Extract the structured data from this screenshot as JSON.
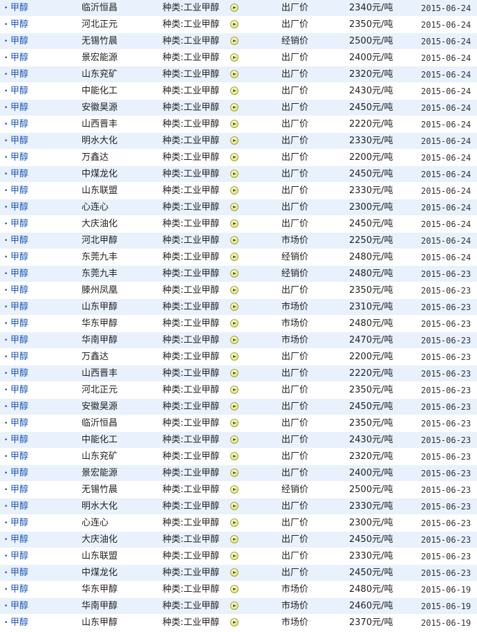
{
  "colors": {
    "row_alt_bg": "#e9f1fc",
    "row_bg": "#ffffff",
    "link": "#1b57b8",
    "icon": "#f1ee9a"
  },
  "icons": {
    "bullet": "•",
    "go": "arrow-go-icon"
  },
  "rows": [
    {
      "product": "甲醇",
      "company": "临沂恒昌",
      "category": "种类:工业甲醇",
      "price_type": "出厂价",
      "price": "2340元/吨",
      "date": "2015-06-24"
    },
    {
      "product": "甲醇",
      "company": "河北正元",
      "category": "种类:工业甲醇",
      "price_type": "出厂价",
      "price": "2350元/吨",
      "date": "2015-06-24"
    },
    {
      "product": "甲醇",
      "company": "无锡竹晨",
      "category": "种类:工业甲醇",
      "price_type": "经销价",
      "price": "2500元/吨",
      "date": "2015-06-24"
    },
    {
      "product": "甲醇",
      "company": "景宏能源",
      "category": "种类:工业甲醇",
      "price_type": "出厂价",
      "price": "2400元/吨",
      "date": "2015-06-24"
    },
    {
      "product": "甲醇",
      "company": "山东兖矿",
      "category": "种类:工业甲醇",
      "price_type": "出厂价",
      "price": "2320元/吨",
      "date": "2015-06-24"
    },
    {
      "product": "甲醇",
      "company": "中能化工",
      "category": "种类:工业甲醇",
      "price_type": "出厂价",
      "price": "2430元/吨",
      "date": "2015-06-24"
    },
    {
      "product": "甲醇",
      "company": "安徽昊源",
      "category": "种类:工业甲醇",
      "price_type": "出厂价",
      "price": "2450元/吨",
      "date": "2015-06-24"
    },
    {
      "product": "甲醇",
      "company": "山西晋丰",
      "category": "种类:工业甲醇",
      "price_type": "出厂价",
      "price": "2220元/吨",
      "date": "2015-06-24"
    },
    {
      "product": "甲醇",
      "company": "明水大化",
      "category": "种类:工业甲醇",
      "price_type": "出厂价",
      "price": "2330元/吨",
      "date": "2015-06-24"
    },
    {
      "product": "甲醇",
      "company": "万鑫达",
      "category": "种类:工业甲醇",
      "price_type": "出厂价",
      "price": "2200元/吨",
      "date": "2015-06-24"
    },
    {
      "product": "甲醇",
      "company": "中煤龙化",
      "category": "种类:工业甲醇",
      "price_type": "出厂价",
      "price": "2450元/吨",
      "date": "2015-06-24"
    },
    {
      "product": "甲醇",
      "company": "山东联盟",
      "category": "种类:工业甲醇",
      "price_type": "出厂价",
      "price": "2330元/吨",
      "date": "2015-06-24"
    },
    {
      "product": "甲醇",
      "company": "心连心",
      "category": "种类:工业甲醇",
      "price_type": "出厂价",
      "price": "2300元/吨",
      "date": "2015-06-24"
    },
    {
      "product": "甲醇",
      "company": "大庆油化",
      "category": "种类:工业甲醇",
      "price_type": "出厂价",
      "price": "2450元/吨",
      "date": "2015-06-24"
    },
    {
      "product": "甲醇",
      "company": "河北甲醇",
      "category": "种类:工业甲醇",
      "price_type": "市场价",
      "price": "2250元/吨",
      "date": "2015-06-24"
    },
    {
      "product": "甲醇",
      "company": "东莞九丰",
      "category": "种类:工业甲醇",
      "price_type": "经销价",
      "price": "2480元/吨",
      "date": "2015-06-24"
    },
    {
      "product": "甲醇",
      "company": "东莞九丰",
      "category": "种类:工业甲醇",
      "price_type": "经销价",
      "price": "2480元/吨",
      "date": "2015-06-23"
    },
    {
      "product": "甲醇",
      "company": "滕州凤凰",
      "category": "种类:工业甲醇",
      "price_type": "出厂价",
      "price": "2350元/吨",
      "date": "2015-06-23"
    },
    {
      "product": "甲醇",
      "company": "山东甲醇",
      "category": "种类:工业甲醇",
      "price_type": "市场价",
      "price": "2310元/吨",
      "date": "2015-06-23"
    },
    {
      "product": "甲醇",
      "company": "华东甲醇",
      "category": "种类:工业甲醇",
      "price_type": "市场价",
      "price": "2480元/吨",
      "date": "2015-06-23"
    },
    {
      "product": "甲醇",
      "company": "华南甲醇",
      "category": "种类:工业甲醇",
      "price_type": "市场价",
      "price": "2470元/吨",
      "date": "2015-06-23"
    },
    {
      "product": "甲醇",
      "company": "万鑫达",
      "category": "种类:工业甲醇",
      "price_type": "出厂价",
      "price": "2200元/吨",
      "date": "2015-06-23"
    },
    {
      "product": "甲醇",
      "company": "山西晋丰",
      "category": "种类:工业甲醇",
      "price_type": "出厂价",
      "price": "2220元/吨",
      "date": "2015-06-23"
    },
    {
      "product": "甲醇",
      "company": "河北正元",
      "category": "种类:工业甲醇",
      "price_type": "出厂价",
      "price": "2350元/吨",
      "date": "2015-06-23"
    },
    {
      "product": "甲醇",
      "company": "安徽昊源",
      "category": "种类:工业甲醇",
      "price_type": "出厂价",
      "price": "2450元/吨",
      "date": "2015-06-23"
    },
    {
      "product": "甲醇",
      "company": "临沂恒昌",
      "category": "种类:工业甲醇",
      "price_type": "出厂价",
      "price": "2350元/吨",
      "date": "2015-06-23"
    },
    {
      "product": "甲醇",
      "company": "中能化工",
      "category": "种类:工业甲醇",
      "price_type": "出厂价",
      "price": "2430元/吨",
      "date": "2015-06-23"
    },
    {
      "product": "甲醇",
      "company": "山东兖矿",
      "category": "种类:工业甲醇",
      "price_type": "出厂价",
      "price": "2320元/吨",
      "date": "2015-06-23"
    },
    {
      "product": "甲醇",
      "company": "景宏能源",
      "category": "种类:工业甲醇",
      "price_type": "出厂价",
      "price": "2400元/吨",
      "date": "2015-06-23"
    },
    {
      "product": "甲醇",
      "company": "无锡竹晨",
      "category": "种类:工业甲醇",
      "price_type": "经销价",
      "price": "2500元/吨",
      "date": "2015-06-23"
    },
    {
      "product": "甲醇",
      "company": "明水大化",
      "category": "种类:工业甲醇",
      "price_type": "出厂价",
      "price": "2330元/吨",
      "date": "2015-06-23"
    },
    {
      "product": "甲醇",
      "company": "心连心",
      "category": "种类:工业甲醇",
      "price_type": "出厂价",
      "price": "2300元/吨",
      "date": "2015-06-23"
    },
    {
      "product": "甲醇",
      "company": "大庆油化",
      "category": "种类:工业甲醇",
      "price_type": "出厂价",
      "price": "2450元/吨",
      "date": "2015-06-23"
    },
    {
      "product": "甲醇",
      "company": "山东联盟",
      "category": "种类:工业甲醇",
      "price_type": "出厂价",
      "price": "2330元/吨",
      "date": "2015-06-23"
    },
    {
      "product": "甲醇",
      "company": "中煤龙化",
      "category": "种类:工业甲醇",
      "price_type": "出厂价",
      "price": "2450元/吨",
      "date": "2015-06-23"
    },
    {
      "product": "甲醇",
      "company": "华东甲醇",
      "category": "种类:工业甲醇",
      "price_type": "市场价",
      "price": "2480元/吨",
      "date": "2015-06-19"
    },
    {
      "product": "甲醇",
      "company": "华南甲醇",
      "category": "种类:工业甲醇",
      "price_type": "市场价",
      "price": "2460元/吨",
      "date": "2015-06-19"
    },
    {
      "product": "甲醇",
      "company": "山东甲醇",
      "category": "种类:工业甲醇",
      "price_type": "市场价",
      "price": "2370元/吨",
      "date": "2015-06-19"
    }
  ]
}
